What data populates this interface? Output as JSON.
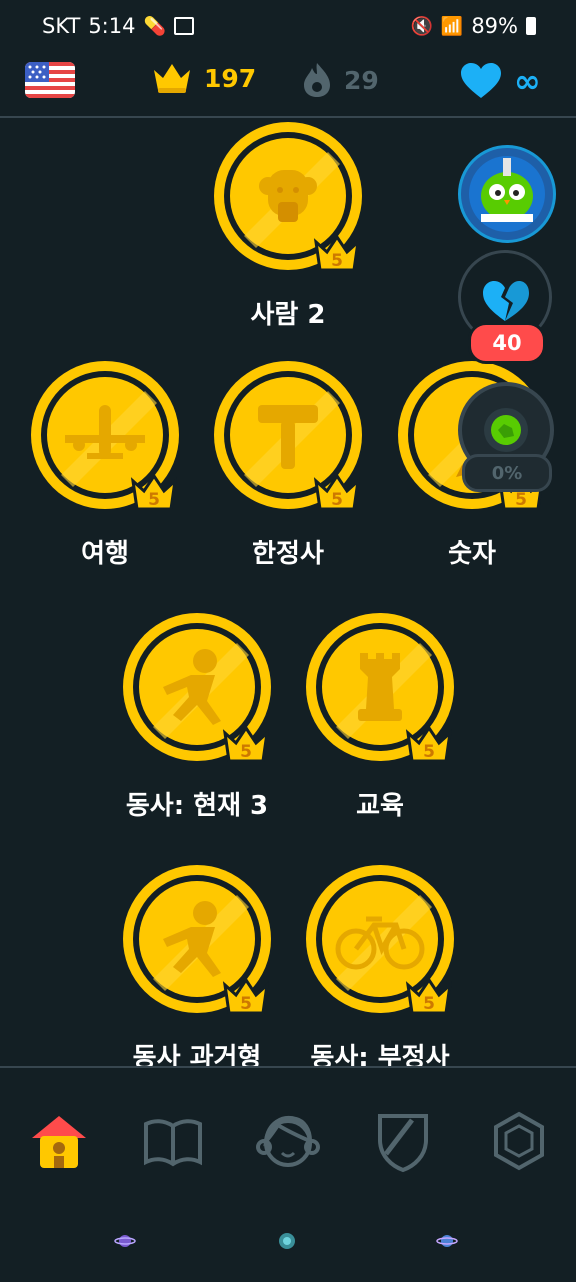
{
  "status_bar": {
    "carrier": "SKT",
    "time": "5:14",
    "battery": "89%"
  },
  "top_bar": {
    "language_flag": "us-flag-icon",
    "crowns": "197",
    "streak": "29",
    "hearts": "∞"
  },
  "side_widgets": {
    "broken_heart_count": "40",
    "chest_progress": "0%"
  },
  "skills": [
    {
      "label": "사람 2",
      "level": "5",
      "icon": "person-face-icon"
    },
    {
      "label": "여행",
      "level": "5",
      "icon": "airplane-icon"
    },
    {
      "label": "한정사",
      "level": "5",
      "icon": "hammer-icon"
    },
    {
      "label": "숫자",
      "level": "5",
      "icon": "pencil-icon"
    },
    {
      "label": "동사: 현재 3",
      "level": "5",
      "icon": "running-person-icon"
    },
    {
      "label": "교육",
      "level": "5",
      "icon": "chess-rook-icon"
    },
    {
      "label": "동사 과거형",
      "level": "5",
      "icon": "running-person-icon"
    },
    {
      "label": "동사: 부정사",
      "level": "5",
      "icon": "bicycle-icon"
    }
  ],
  "bottom_nav": {
    "items": [
      "home-icon",
      "stories-book-icon",
      "profile-face-icon",
      "league-shield-icon",
      "shop-gem-icon"
    ]
  },
  "colors": {
    "background": "#131f24",
    "gold": "#ffc800",
    "gold_dark": "#e5a800",
    "accent_blue": "#1cb0f6",
    "muted": "#52656d",
    "red": "#ff4b4b"
  }
}
